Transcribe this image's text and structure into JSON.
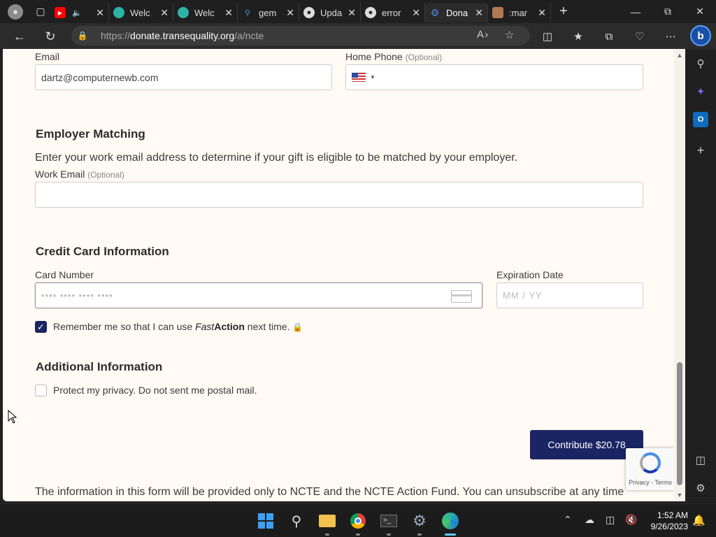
{
  "browser": {
    "tabs": [
      {
        "label": "",
        "icon": "youtube-icon",
        "color": "#ff0000"
      },
      {
        "label": "Welc",
        "icon": "edge-icon",
        "color": "#2cb3a4"
      },
      {
        "label": "Welc",
        "icon": "edge-icon",
        "color": "#2cb3a4"
      },
      {
        "label": "gem",
        "icon": "search-icon",
        "color": "#4a90e2"
      },
      {
        "label": "Upda",
        "icon": "github-icon",
        "color": "#ffffff"
      },
      {
        "label": "error",
        "icon": "github-icon",
        "color": "#ffffff"
      },
      {
        "label": "Dona",
        "icon": "gear-icon",
        "color": "#4a90e2"
      },
      {
        "label": ":mar",
        "icon": "avatar-icon",
        "color": "#b07a50"
      }
    ],
    "active_tab_index": 6,
    "url_prefix": "https://",
    "url_domain": "donate.transequality.org",
    "url_path": "/a/ncte"
  },
  "form": {
    "email_label": "Email",
    "email_value": "dartz@computernewb.com",
    "phone_label": "Home Phone",
    "phone_optional": "(Optional)",
    "employer_heading": "Employer Matching",
    "employer_text": "Enter your work email address to determine if your gift is eligible to be matched by your employer.",
    "work_email_label": "Work Email",
    "work_email_optional": "(Optional)",
    "card_heading": "Credit Card Information",
    "card_number_label": "Card Number",
    "card_number_placeholder": "•••• •••• •••• ••••",
    "expiration_label": "Expiration Date",
    "expiration_placeholder": "MM / YY",
    "remember_prefix": "Remember me so that I can use ",
    "remember_fast": "Fast",
    "remember_action": "Action",
    "remember_suffix": " next time.",
    "remember_checked": true,
    "additional_heading": "Additional Information",
    "privacy_label": "Protect my privacy. Do not sent me postal mail.",
    "privacy_checked": false,
    "contribute_button": "Contribute $20.78",
    "recaptcha_text": "Privacy - Terms",
    "footer_text": "The information in this form will be provided only to NCTE and the NCTE Action Fund. You can unsubscribe at any time"
  },
  "taskbar": {
    "time": "1:52 AM",
    "date": "9/26/2023"
  },
  "colors": {
    "primary_button": "#1b2563",
    "page_bg": "#fffaf3"
  }
}
